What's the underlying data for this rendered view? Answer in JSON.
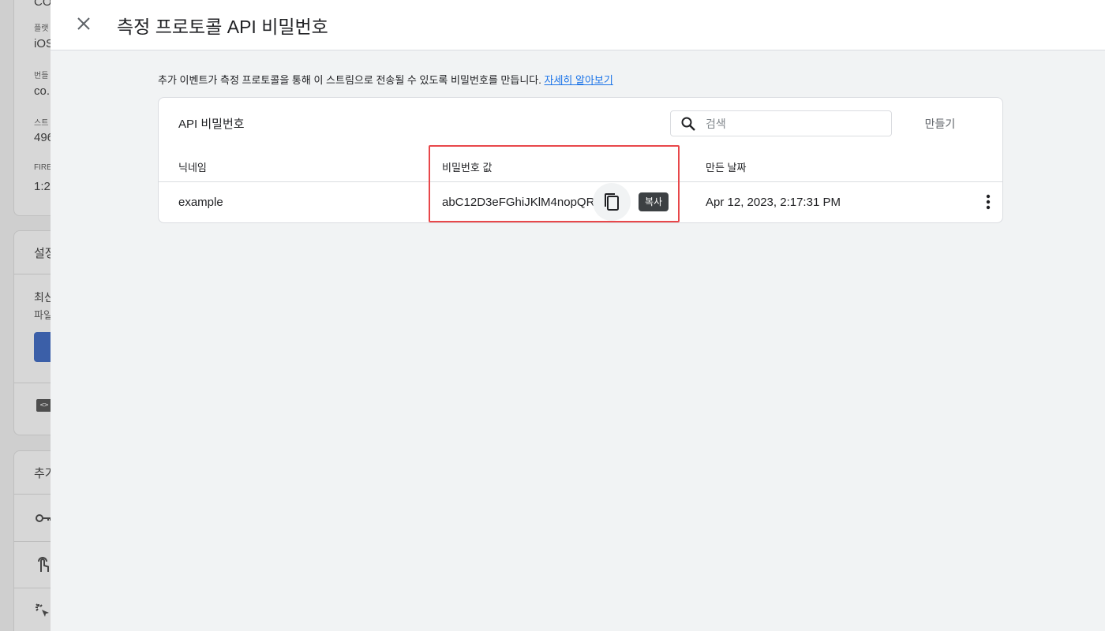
{
  "background": {
    "card1": {
      "items": [
        {
          "label": "플랫",
          "value": "iOS"
        },
        {
          "label": "번들",
          "value": "co."
        },
        {
          "label": "스트",
          "value": "496"
        },
        {
          "label": "FIRE",
          "value": "1:2"
        }
      ],
      "top_text": "CO"
    },
    "card2": {
      "title": "설정",
      "subtitle": "최신",
      "caption": "파일"
    },
    "card3": {
      "title": "추가"
    }
  },
  "panel": {
    "title": "측정 프로토콜 API 비밀번호",
    "description": "추가 이벤트가 측정 프로토콜을 통해 이 스트림으로 전송될 수 있도록 비밀번호를 만듭니다.",
    "learn_more": "자세히 알아보기",
    "card": {
      "title": "API 비밀번호",
      "search_placeholder": "검색",
      "create_label": "만들기",
      "columns": [
        "닉네임",
        "비밀번호 값",
        "만든 날짜"
      ],
      "rows": [
        {
          "nickname": "example",
          "secret": "abC12D3eFGhiJKlM4nopQR",
          "created": "Apr 12, 2023, 2:17:31 PM"
        }
      ],
      "copy_tooltip": "복사"
    }
  },
  "colors": {
    "accent": "#1a73e8",
    "highlight": "#e8474a",
    "tooltip_bg": "#3c4043"
  }
}
